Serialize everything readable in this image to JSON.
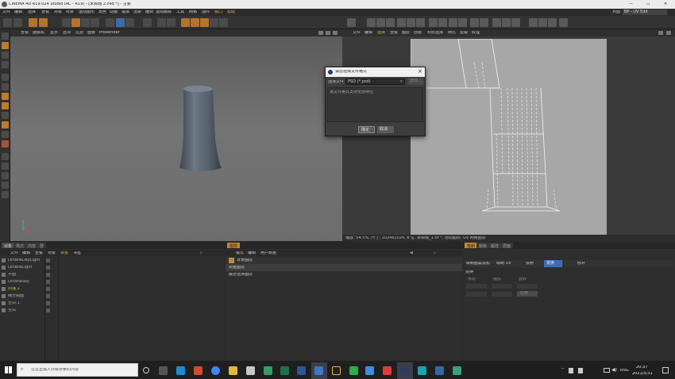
{
  "window": {
    "title": "CINEMA 4D R19.024 Studio (RC - R19) - [未标题 2.c4d *] - 主要",
    "controls": [
      "—",
      "❐",
      "✕"
    ]
  },
  "menu": {
    "items": [
      "文件",
      "编辑",
      "选择",
      "查看",
      "对象",
      "样条",
      "运动图形",
      "角色",
      "动画",
      "模拟",
      "渲染",
      "雕刻",
      "运动跟踪",
      "工具",
      "网格",
      "插件",
      "窗口",
      "帮助"
    ],
    "layout_label": "界面",
    "layout_value": "BP - UV Edit"
  },
  "viewport": {
    "menu": [
      "查看",
      "摄像机",
      "显示",
      "选项",
      "过滤",
      "面板",
      "ProRender"
    ]
  },
  "uv": {
    "menu": [
      "文件",
      "编辑",
      "选择",
      "查看",
      "图层",
      "创建",
      "材质选择",
      "网孔",
      "滤镜",
      "纹理"
    ],
    "status": "缩放: 54.5%, 尺寸: 1024x1024, 8 位, 未标题_1.tif *, 活动图层: UV 网格图层"
  },
  "dialog": {
    "title": "请您选择文件格式",
    "label": "选择文件",
    "format": "PSD (*.psd)",
    "option_btn": "选项...",
    "message": "该文件格式支持全部特性",
    "ok": "确定",
    "cancel": "取消"
  },
  "objects": {
    "tabs": [
      "对象",
      "场次",
      "内容",
      "层"
    ],
    "menu": [
      "文件",
      "编辑",
      "查看",
      "对象",
      "标签",
      "书签"
    ],
    "items": [
      {
        "name": "OctaneDayLight",
        "color": "#b0b0b0"
      },
      {
        "name": "OctaneLight",
        "color": "#b0b0b0"
      },
      {
        "name": "平面",
        "color": "#b0b0b0"
      },
      {
        "name": "OctaneSky",
        "color": "#b0b0b0"
      },
      {
        "name": "扫描.1",
        "color": "#e8b34a"
      },
      {
        "name": "细分曲面",
        "color": "#b0b0b0"
      },
      {
        "name": "空白.1",
        "color": "#b0b0b0"
      },
      {
        "name": "空白",
        "color": "#b0b0b0"
      }
    ]
  },
  "layers": {
    "tab": "图层",
    "menu": [
      "模式",
      "编辑",
      "用户数据"
    ],
    "rows": [
      "背景图层",
      "调整图层",
      "最近选择图层"
    ]
  },
  "attributes": {
    "tabs": [
      "笔刷",
      "颜色",
      "属性",
      "层面"
    ],
    "buttons": [
      "绘制图案投影",
      "绘制 UV",
      "投射",
      "变换",
      "修补"
    ],
    "section": "变换",
    "field_labels": [
      "移动",
      "缩放",
      "旋转"
    ],
    "apply": "应用"
  },
  "taskbar": {
    "search_placeholder": "在这里输入你要搜索的内容",
    "time": "20:37",
    "date": "2021/5/31",
    "lang": "ENG",
    "volume": "中"
  }
}
